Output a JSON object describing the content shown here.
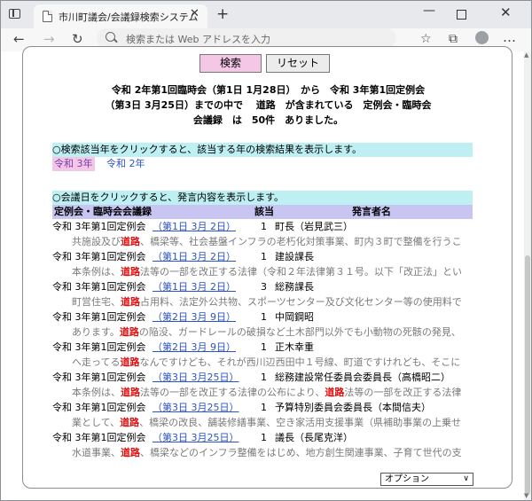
{
  "browser": {
    "tab_title": "市川町議会/会議録検索システム",
    "tab_close": "✕",
    "new_tab": "+",
    "address_placeholder": "検索または Web アドレスを入力",
    "min": "—",
    "close": "✕",
    "back": "←",
    "forward": "→",
    "refresh": "↻",
    "favorite": "☆",
    "collections": "⧉",
    "more": "…"
  },
  "page": {
    "buttons": {
      "search": "検索",
      "reset": "リセット"
    },
    "summary": [
      "令和 2年第1回臨時会（第1日 1月28日）　から　令和 3年第1回定例会",
      "（第3日 3月25日）までの中で　 道路　が含まれている　定例会・臨時会",
      "会議録　は　50件　ありました。"
    ],
    "year_hint": "○検索該当年をクリックすると、該当する年の検索結果を表示します。",
    "years": [
      "令和 3年",
      "令和 2年"
    ],
    "day_hint": "○会議日をクリックすると、発言内容を表示します。",
    "columns": {
      "session": "定例会・臨時会会議録",
      "hit": "該当",
      "speaker": "発言者名"
    },
    "option_label": "オプション",
    "option_chev": "∨",
    "rows": [
      {
        "session": "令和 3年第1回定例会",
        "date": "（第1日 3月 2日）",
        "num": "1",
        "speaker": "町長（岩見武三）",
        "snippet": {
          "pre": "共施設及び",
          "kw": "道路",
          "post": "、橋梁等、社会基盤インフラの老朽化対策事業、町内３町で整備を行うこ"
        }
      },
      {
        "session": "令和 3年第1回定例会",
        "date": "（第1日 3月 2日）",
        "num": "1",
        "speaker": "建設課長",
        "snippet": {
          "pre": "本条例は、",
          "kw": "道路",
          "post": "法等の一部を改正する法律（令和２年法律第３１号。以下「改正法」とい"
        }
      },
      {
        "session": "令和 3年第1回定例会",
        "date": "（第1日 3月 2日）",
        "num": "3",
        "speaker": "総務課長",
        "snippet": {
          "pre": "町営住宅、",
          "kw": "道路",
          "post": "占用料、法定外公共物、スポーツセンター及び文化センター等の使用料で"
        }
      },
      {
        "session": "令和 3年第1回定例会",
        "date": "（第2日 3月 9日）",
        "num": "1",
        "speaker": "中岡鋼昭",
        "snippet": {
          "pre": "あります。",
          "kw": "道路",
          "post": "の陥没、ガードレールの破損など土木部門以外でも小動物の死骸の発見、"
        }
      },
      {
        "session": "令和 3年第1回定例会",
        "date": "（第2日 3月 9日）",
        "num": "1",
        "speaker": "正木幸重",
        "snippet": {
          "pre": "へ走ってる",
          "kw": "道路",
          "post": "なんですけども、それが西川辺西田中１号線、町道ですけれども、そこに"
        }
      },
      {
        "session": "令和 3年第1回定例会",
        "date": "（第3日 3月25日）",
        "num": "1",
        "speaker": "総務建設常任委員会委員長（高橋昭二）",
        "snippet": {
          "pre": "本条例は、",
          "kw": "道路",
          "post": "法等の一部を改正する法律の公布により、",
          "kw2": "道路",
          "post2": "法等の一部を改正する法律"
        }
      },
      {
        "session": "令和 3年第1回定例会",
        "date": "（第3日 3月25日）",
        "num": "1",
        "speaker": "予算特別委員会委員長（本間信夫）",
        "snippet": {
          "pre": "業として、",
          "kw": "道路",
          "post": "、橋梁の改良、舗装修繕事業、空き家活用支援事業（県補助事業の上乗せ"
        }
      },
      {
        "session": "令和 3年第1回定例会",
        "date": "（第3日 3月25日）",
        "num": "1",
        "speaker": "議長（長尾克洋）",
        "snippet": {
          "pre": "水道事業、",
          "kw": "道路",
          "post": "、橋梁などのインフラ整備をはじめ、地方創生関連事業、子育て世代の支"
        }
      }
    ]
  }
}
